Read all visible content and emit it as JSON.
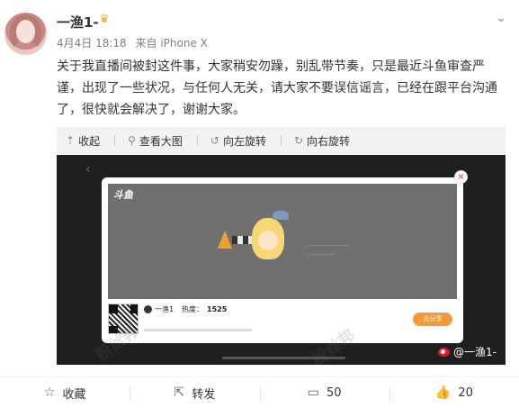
{
  "post": {
    "username": "一渔1-",
    "crown_icon": "crown-icon",
    "date": "4月4日 18:18",
    "source": "来自 iPhone X",
    "text": "关于我直播间被封这件事，大家稍安勿躁，别乱带节奏，只是最近斗鱼审查严谨，出现了一些状况，与任何人无关，请大家不要误信谣言，已经在跟平台沟通了，很快就会解决了，谢谢大家。"
  },
  "toolbar": {
    "collapse": "收起",
    "view_large": "查看大图",
    "rotate_left": "向左旋转",
    "rotate_right": "向右旋转"
  },
  "screenshot": {
    "logo": "斗鱼",
    "anchor_name": "一渔1",
    "heat_label": "热度：",
    "heat_value": "1525",
    "share_label": "去分享",
    "close_symbol": "×",
    "watermark": "粉丝邦",
    "credit": "@一渔1-"
  },
  "actions": {
    "favorite": "收藏",
    "repost": "转发",
    "comment_count": "50",
    "like_count": "20"
  },
  "colors": {
    "accent_orange": "#f59a3a",
    "weibo_red": "#e6162d"
  }
}
